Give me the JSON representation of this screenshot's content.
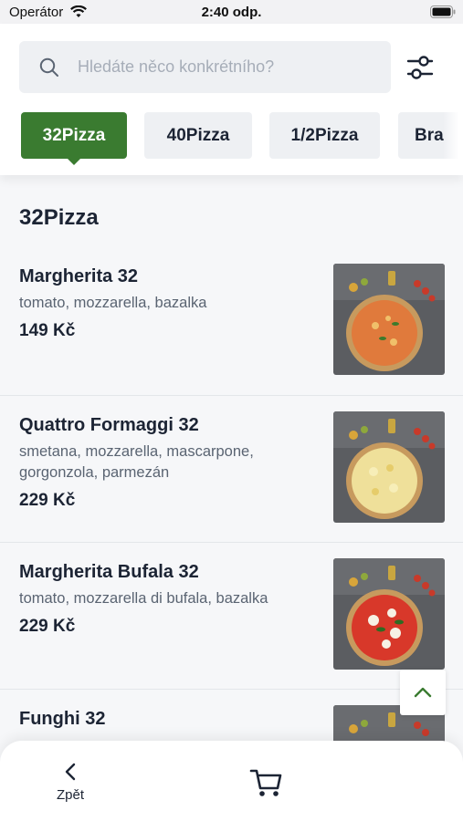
{
  "status_bar": {
    "carrier": "Operátor",
    "time": "2:40 odp."
  },
  "search": {
    "placeholder": "Hledáte něco konkrétního?",
    "value": ""
  },
  "header": {
    "filter_icon": "sliders-icon"
  },
  "tabs": [
    {
      "label": "32Pizza",
      "active": true
    },
    {
      "label": "40Pizza",
      "active": false
    },
    {
      "label": "1/2Pizza",
      "active": false
    },
    {
      "label": "Bra",
      "active": false
    }
  ],
  "section": {
    "title": "32Pizza"
  },
  "items": [
    {
      "name": "Margherita 32",
      "description": "tomato, mozzarella, bazalka",
      "price": "149 Kč"
    },
    {
      "name": "Quattro Formaggi 32",
      "description": "smetana, mozzarella, mascarpone, gorgonzola, parmezán",
      "price": "229 Kč"
    },
    {
      "name": "Margherita Bufala 32",
      "description": "tomato, mozzarella di bufala, bazalka",
      "price": "229 Kč"
    },
    {
      "name": "Funghi 32",
      "description": "",
      "price": ""
    }
  ],
  "bottom_bar": {
    "back_label": "Zpět",
    "cart_icon": "cart-icon"
  },
  "colors": {
    "accent": "#3a7b30",
    "text": "#1c2434",
    "muted": "#5a6472"
  }
}
